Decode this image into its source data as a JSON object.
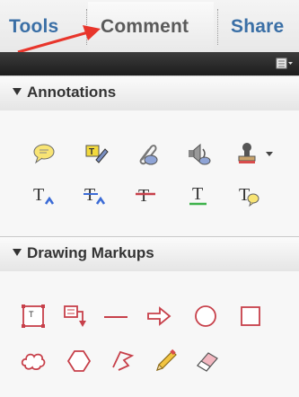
{
  "tabs": [
    {
      "label": "Tools"
    },
    {
      "label": "Comment"
    },
    {
      "label": "Share"
    }
  ],
  "sections": {
    "annotations": {
      "title": "Annotations",
      "tools": [
        "sticky-note",
        "highlight-text",
        "attach-file",
        "record-audio",
        "add-stamp",
        "insert-text",
        "replace-text",
        "strikethrough-text",
        "underline-text",
        "add-note-to-text"
      ]
    },
    "drawing": {
      "title": "Drawing Markups",
      "tools": [
        "text-box",
        "text-callout",
        "line",
        "arrow",
        "oval",
        "rectangle",
        "cloud",
        "polygon",
        "connected-lines",
        "pencil",
        "eraser"
      ]
    }
  },
  "accent_color": "#3a6fa6",
  "markup_color": "#c7404a"
}
